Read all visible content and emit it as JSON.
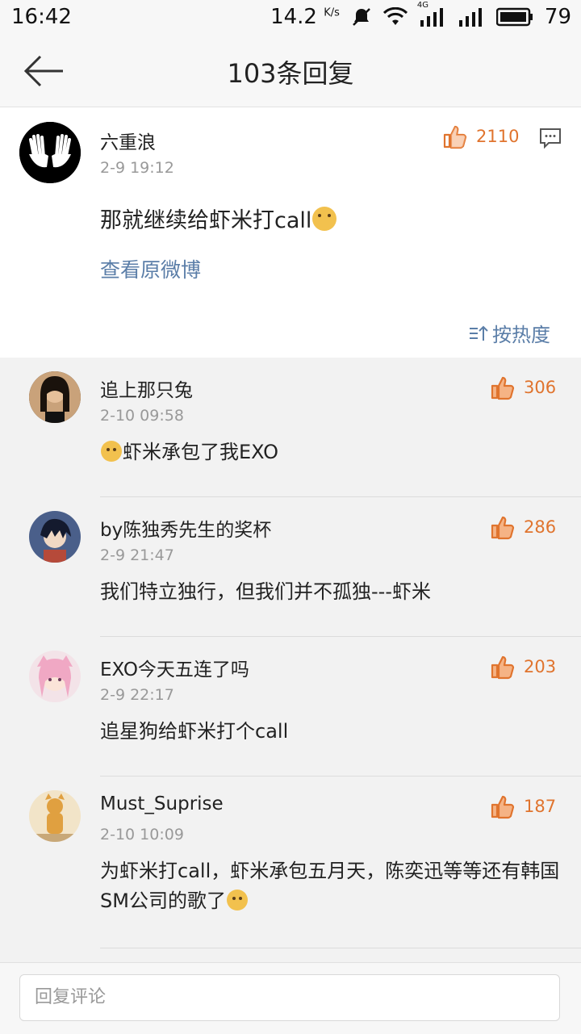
{
  "status_bar": {
    "time": "16:42",
    "speed": "14.2",
    "speed_unit": "K/s",
    "network": "4G",
    "battery": "79"
  },
  "header": {
    "title": "103条回复"
  },
  "main_post": {
    "username": "六重浪",
    "time": "2-9 19:12",
    "likes": "2110",
    "text": "那就继续给虾米打call",
    "view_original": "查看原微博",
    "sort_label": "按热度"
  },
  "replies": [
    {
      "username": "追上那只兔",
      "time": "2-10 09:58",
      "likes": "306",
      "text": "虾米承包了我EXO"
    },
    {
      "username": "by陈独秀先生的奖杯",
      "time": "2-9 21:47",
      "likes": "286",
      "text": "我们特立独行，但我们并不孤独---虾米"
    },
    {
      "username": "EXO今天五连了吗",
      "time": "2-9 22:17",
      "likes": "203",
      "text": "追星狗给虾米打个call"
    },
    {
      "username": "Must_Suprise",
      "time": "2-10 10:09",
      "likes": "187",
      "text": "为虾米打call，虾米承包五月天，陈奕迅等等还有韩国SM公司的歌了"
    }
  ],
  "footer": {
    "input_placeholder": "回复评论"
  },
  "colors": {
    "accent": "#e0742e",
    "link": "#5b7ea8",
    "background": "#f2f2f2"
  }
}
